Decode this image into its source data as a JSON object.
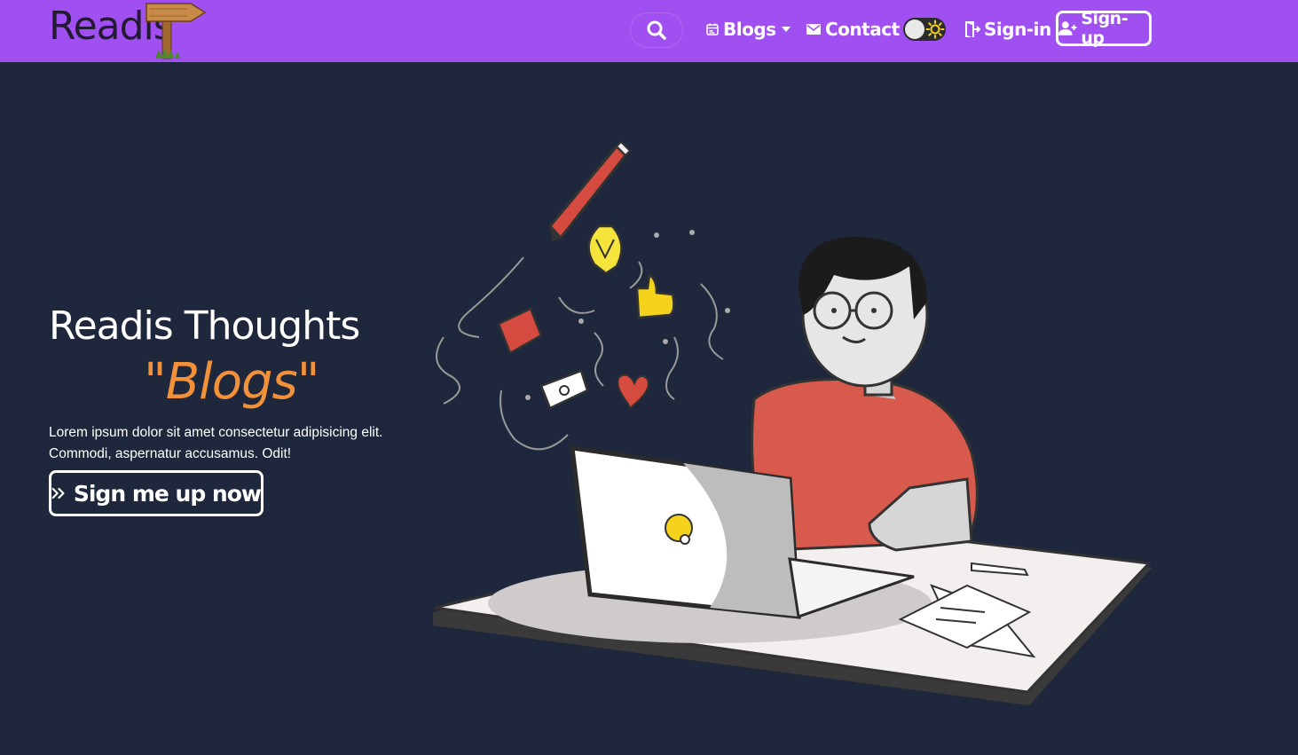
{
  "brand": {
    "name": "Readis",
    "logo_icon": "signpost-icon"
  },
  "nav": {
    "search_icon": "search-icon",
    "blogs_label": "Blogs",
    "contact_label": "Contact",
    "signin_label": "Sign-in",
    "signup_label": "Sign-up",
    "theme_toggle": {
      "state": "light",
      "icon": "sun-icon"
    }
  },
  "hero": {
    "title": "Readis Thoughts",
    "accent": "\"Blogs\"",
    "description": "Lorem ipsum dolor sit amet consectetur adipisicing elit. Commodi, aspernatur accusamus. Odit!",
    "cta_label": "Sign me up now",
    "cta_icon": "double-chevron-right-icon"
  },
  "colors": {
    "navbar_bg": "#a04ff0",
    "page_bg": "#1e273b",
    "accent_text": "#f2913a",
    "text": "#ffffff"
  }
}
